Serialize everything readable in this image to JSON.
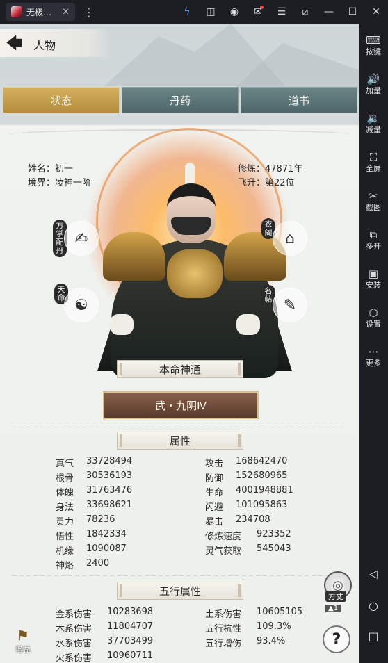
{
  "window": {
    "tab_title": "无极…",
    "tab_close": "✕",
    "menu": "⋮"
  },
  "toolbar_icons": [
    "lightning-icon",
    "gamepad-icon",
    "account-icon",
    "mail-icon",
    "menu-icon",
    "pin-icon",
    "minimize-icon",
    "maximize-icon",
    "close-icon"
  ],
  "sidebar": {
    "items": [
      {
        "icon": "⌨",
        "label": "按键"
      },
      {
        "icon": "🔊",
        "label": "加量"
      },
      {
        "icon": "🔉",
        "label": "减量"
      },
      {
        "icon": "⛶",
        "label": "全屏"
      },
      {
        "icon": "✂",
        "label": "截图"
      },
      {
        "icon": "⧉",
        "label": "多开"
      },
      {
        "icon": "▣",
        "label": "安装"
      },
      {
        "icon": "⬡",
        "label": "设置"
      },
      {
        "icon": "⋯",
        "label": "更多"
      }
    ],
    "nav": {
      "back": "◁",
      "home": "○",
      "recent": "□"
    }
  },
  "header": {
    "title": "人物"
  },
  "tabs": [
    {
      "label": "状态",
      "active": true
    },
    {
      "label": "丹药",
      "active": false
    },
    {
      "label": "道书",
      "active": false
    }
  ],
  "profile": {
    "name_label": "姓名：初一",
    "realm_label": "境界：凌神一阶",
    "cultivation_label": "修炼：47871年",
    "ascend_label": "飞升：第22位"
  },
  "side_buttons": {
    "fangzhang": "方掌\n配丹",
    "yige": "衣\n阁",
    "tianming": "天\n命",
    "mingtie": "名\n帖"
  },
  "benming": {
    "title": "本命神通",
    "skill": "武・九阴Ⅳ"
  },
  "attributes": {
    "title": "属性",
    "left": [
      {
        "k": "真气",
        "v": "33728494"
      },
      {
        "k": "根骨",
        "v": "30536193"
      },
      {
        "k": "体魄",
        "v": "31763476"
      },
      {
        "k": "身法",
        "v": "33698621"
      },
      {
        "k": "灵力",
        "v": "78236"
      },
      {
        "k": "悟性",
        "v": "1842334"
      },
      {
        "k": "机缘",
        "v": "1090087"
      },
      {
        "k": "神烙",
        "v": "2400"
      }
    ],
    "right": [
      {
        "k": "攻击",
        "v": "168642470"
      },
      {
        "k": "防御",
        "v": "152680965"
      },
      {
        "k": "生命",
        "v": "4001948881"
      },
      {
        "k": "闪避",
        "v": "101095863"
      },
      {
        "k": "暴击",
        "v": "234708"
      },
      {
        "k": "修炼速度",
        "v": "923352"
      },
      {
        "k": "灵气获取",
        "v": "545043"
      }
    ]
  },
  "wuxing": {
    "title": "五行属性",
    "left": [
      {
        "k": "金系伤害",
        "v": "10283698"
      },
      {
        "k": "木系伤害",
        "v": "11804707"
      },
      {
        "k": "水系伤害",
        "v": "37703499"
      },
      {
        "k": "火系伤害",
        "v": "10960711"
      }
    ],
    "right": [
      {
        "k": "土系伤害",
        "v": "10605105"
      },
      {
        "k": "五行抗性",
        "v": "109.3%"
      },
      {
        "k": "五行增伤",
        "v": "93.4%"
      }
    ]
  },
  "floating": {
    "fangzhang": "方丈",
    "count": "▲1",
    "help": "?",
    "zengyi": "增益"
  }
}
